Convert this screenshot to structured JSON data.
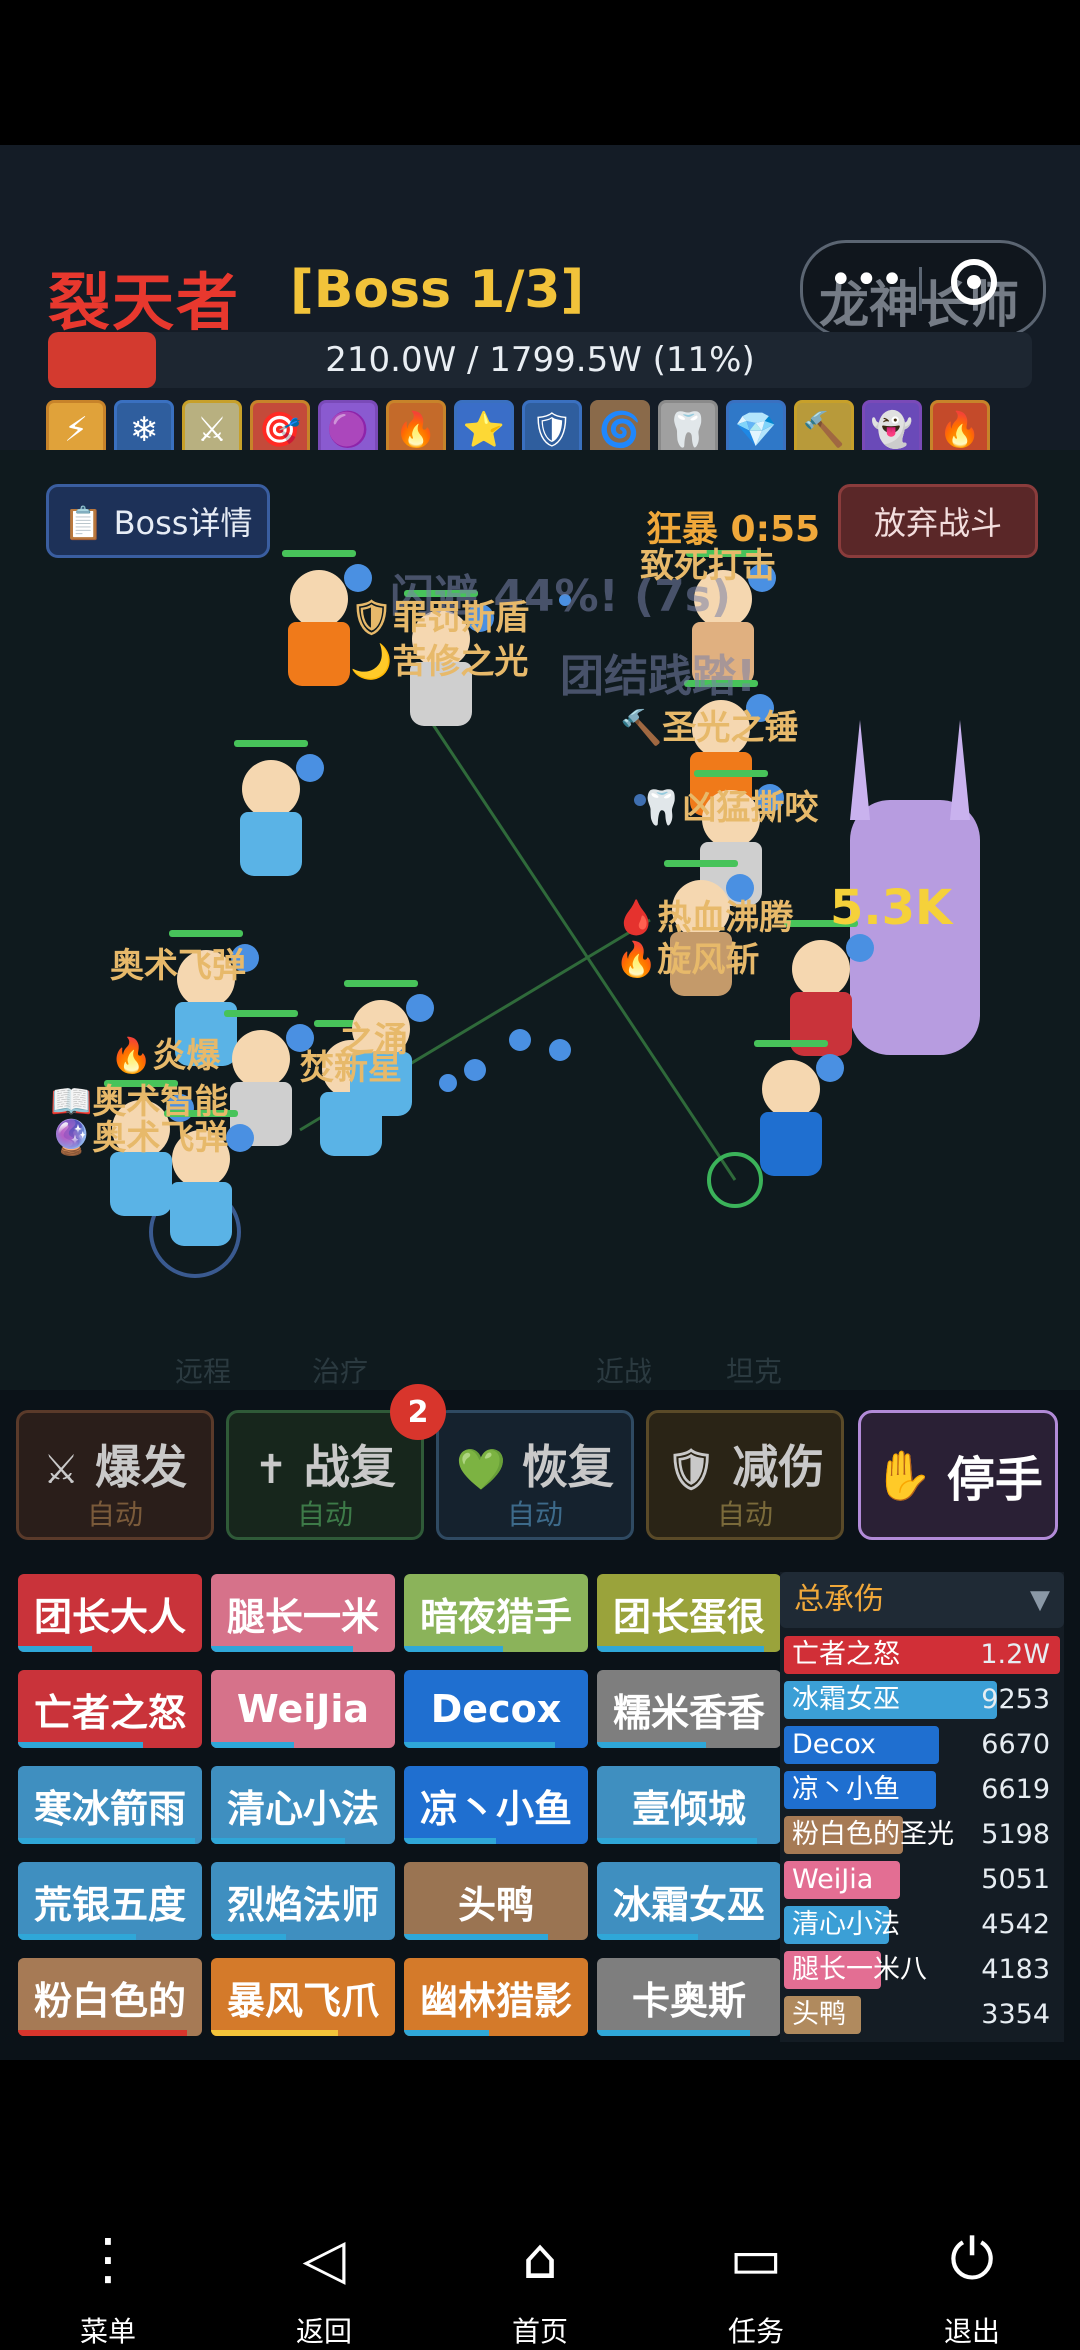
{
  "header": {
    "boss_name": "裂天者",
    "boss_stage": "[Boss 1/3]",
    "hp_text": "210.0W / 1799.5W (11%)",
    "hp_fraction": 0.11,
    "capsule_overlay": "龙神长师",
    "buffs": [
      "⚡",
      "❄",
      "⚔",
      "🎯",
      "🟣",
      "🔥",
      "⭐",
      "🛡",
      "🌀",
      "🦷",
      "💎",
      "🔨",
      "👻",
      "🔥"
    ]
  },
  "arena": {
    "boss_detail_label": "📋 Boss详情",
    "give_up_label": "放弃战斗",
    "rage_label": "狂暴 0:55",
    "floating_texts": [
      {
        "text": "闪避 44%! (7s)",
        "cls": "fade"
      },
      {
        "text": "团结践踏!",
        "cls": "fade"
      },
      {
        "text": "致死打击",
        "cls": ""
      },
      {
        "text": "🛡罪罚斯盾",
        "cls": ""
      },
      {
        "text": "🌙苦修之光",
        "cls": ""
      },
      {
        "text": "🔨圣光之锤",
        "cls": ""
      },
      {
        "text": "🦷凶猛撕咬",
        "cls": ""
      },
      {
        "text": "🩸热血沸腾",
        "cls": ""
      },
      {
        "text": "🔥旋风斩",
        "cls": ""
      },
      {
        "text": "5.3K",
        "cls": "big"
      },
      {
        "text": "奥术飞弹",
        "cls": ""
      },
      {
        "text": "🔥炎爆",
        "cls": ""
      },
      {
        "text": "焚新星",
        "cls": ""
      },
      {
        "text": "之涌",
        "cls": ""
      },
      {
        "text": "📖奥术智能",
        "cls": ""
      },
      {
        "text": "🔮奥术飞弹",
        "cls": ""
      }
    ],
    "zone_labels": [
      "远程",
      "治疗",
      "近战",
      "坦克"
    ]
  },
  "actions": [
    {
      "icon": "⚔",
      "title": "爆发",
      "sub": "自动"
    },
    {
      "icon": "✝",
      "title": "战复",
      "sub": "自动"
    },
    {
      "icon": "💚",
      "title": "恢复",
      "sub": "自动"
    },
    {
      "icon": "🛡",
      "title": "减伤",
      "sub": "自动"
    }
  ],
  "revive_badge": "2",
  "stop_label": "停手",
  "stop_icon": "✋",
  "roster": [
    {
      "name": "团长大人",
      "bg": "#c9333a",
      "bar": "#2fa7d8"
    },
    {
      "name": "腿长一米",
      "bg": "#d6728a",
      "bar": "#2fa7d8"
    },
    {
      "name": "暗夜猎手",
      "bg": "#8bb35a",
      "bar": "#2fa7d8"
    },
    {
      "name": "团长蛋很",
      "bg": "#9aa33b",
      "bar": "#2fa7d8"
    },
    {
      "name": "亡者之怒",
      "bg": "#c9333a",
      "bar": "#2fa7d8"
    },
    {
      "name": "WeiJia",
      "bg": "#d6728a",
      "bar": "#2fa7d8"
    },
    {
      "name": "Decox",
      "bg": "#1f6fd0",
      "bar": "#2fa7d8"
    },
    {
      "name": "糯米香香",
      "bg": "#7e7e7e",
      "bar": "#2fa7d8"
    },
    {
      "name": "寒冰箭雨",
      "bg": "#3f8fc0",
      "bar": "#2fa7d8"
    },
    {
      "name": "清心小法",
      "bg": "#3f8fc0",
      "bar": "#2fa7d8"
    },
    {
      "name": "凉丶小鱼",
      "bg": "#1f6fd0",
      "bar": "#2fa7d8"
    },
    {
      "name": "壹倾城",
      "bg": "#3f8fc0",
      "bar": "#2fa7d8"
    },
    {
      "name": "荒银五度",
      "bg": "#3f8fc0",
      "bar": "#2fa7d8"
    },
    {
      "name": "烈焰法师",
      "bg": "#3f8fc0",
      "bar": "#2fa7d8"
    },
    {
      "name": "头鸭",
      "bg": "#9a7452",
      "bar": "#2fa7d8"
    },
    {
      "name": "冰霜女巫",
      "bg": "#3f8fc0",
      "bar": "#2fa7d8"
    },
    {
      "name": "粉白色的",
      "bg": "#a67a55",
      "bar": "#d8352c"
    },
    {
      "name": "暴风飞爪",
      "bg": "#d47a2a",
      "bar": "#f2c33a"
    },
    {
      "name": "幽林猎影",
      "bg": "#d47a2a",
      "bar": "#2fa7d8"
    },
    {
      "name": "卡奥斯",
      "bg": "#7e7e7e",
      "bar": "#2fa7d8"
    }
  ],
  "damage_panel": {
    "title": "总承伤",
    "rows": [
      {
        "name": "亡者之怒",
        "value": "1.2W",
        "frac": 1.0,
        "color": "#d12f37"
      },
      {
        "name": "冰霜女巫",
        "value": "9253",
        "frac": 0.77,
        "color": "#3b9fd6"
      },
      {
        "name": "Decox",
        "value": "6670",
        "frac": 0.56,
        "color": "#1f6fd0"
      },
      {
        "name": "凉丶小鱼",
        "value": "6619",
        "frac": 0.55,
        "color": "#1f6fd0"
      },
      {
        "name": "粉白色的圣光",
        "value": "5198",
        "frac": 0.43,
        "color": "#a67a55"
      },
      {
        "name": "WeiJia",
        "value": "5051",
        "frac": 0.42,
        "color": "#e36e93"
      },
      {
        "name": "清心小法",
        "value": "4542",
        "frac": 0.38,
        "color": "#3b9fd6"
      },
      {
        "name": "腿长一米八",
        "value": "4183",
        "frac": 0.35,
        "color": "#e36e93"
      },
      {
        "name": "头鸭",
        "value": "3354",
        "frac": 0.28,
        "color": "#b08a5e"
      }
    ]
  },
  "nav": [
    {
      "icon": "⋮",
      "label": "菜单"
    },
    {
      "icon": "◁",
      "label": "返回"
    },
    {
      "icon": "⌂",
      "label": "首页"
    },
    {
      "icon": "▭",
      "label": "任务"
    },
    {
      "icon": "⏻",
      "label": "退出"
    }
  ]
}
